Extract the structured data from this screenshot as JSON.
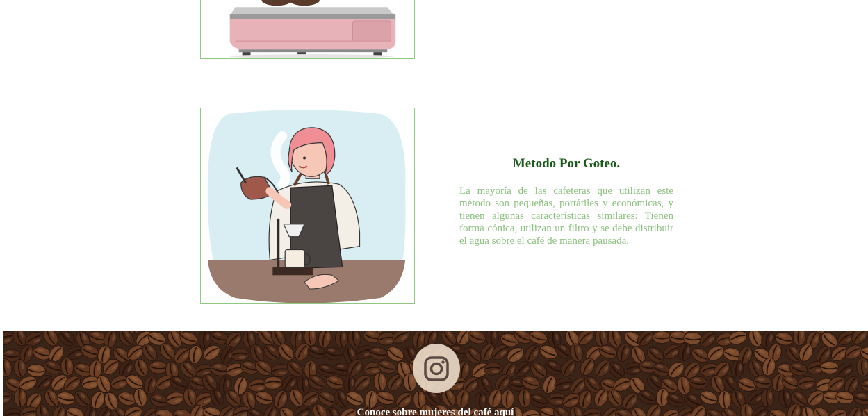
{
  "sections": [
    {
      "image_icon": "coffee-machine-image"
    },
    {
      "image_icon": "drip-coffee-illustration",
      "title": "Metodo Por Goteo.",
      "text": "La mayoría de las cafeteras que utilizan este método son pequeñas, portátiles y económicas, y tienen algunas características similares: Tienen forma cónica, utilizan un filtro y se debe distribuir el agua sobre el café de manera pausada."
    }
  ],
  "footer": {
    "social_icon": "instagram-icon",
    "link_text": "Conoce sobre mujeres del café aquí"
  },
  "colors": {
    "title": "#1c5a1c",
    "body_text": "#8cc07e",
    "frame_border": "#8fc97f"
  }
}
